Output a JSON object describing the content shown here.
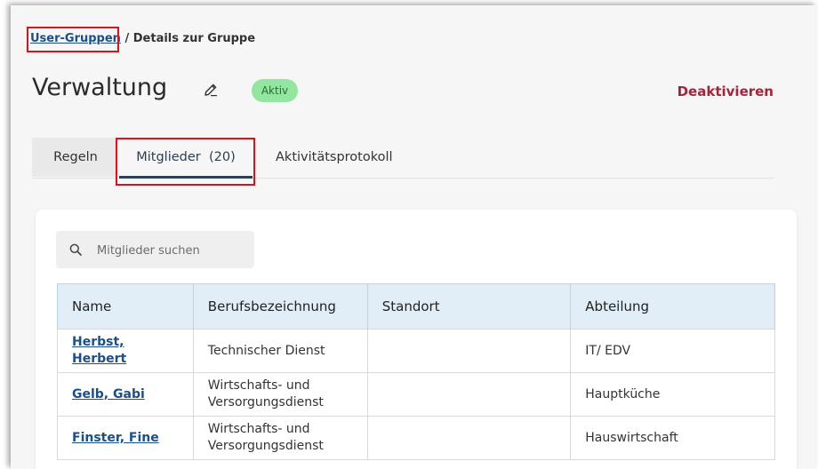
{
  "breadcrumb": {
    "link": "User-Gruppen",
    "separator": " / ",
    "current": "Details zur Gruppe"
  },
  "header": {
    "title": "Verwaltung",
    "status": "Aktiv",
    "deactivate": "Deaktivieren"
  },
  "tabs": [
    {
      "label": "Regeln"
    },
    {
      "label": "Mitglieder  (20)"
    },
    {
      "label": "Aktivitätsprotokoll"
    }
  ],
  "search": {
    "placeholder": "Mitglieder suchen"
  },
  "table": {
    "headers": [
      "Name",
      "Berufsbezeichnung",
      "Standort",
      "Abteilung"
    ],
    "rows": [
      {
        "name": "Herbst, Herbert",
        "job": "Technischer Dienst",
        "location": "",
        "department": "IT/ EDV"
      },
      {
        "name": "Gelb, Gabi",
        "job": "Wirtschafts- und Versorgungsdienst",
        "location": "",
        "department": "Hauptküche"
      },
      {
        "name": "Finster, Fine",
        "job": "Wirtschafts- und Versorgungsdienst",
        "location": "",
        "department": "Hauswirtschaft"
      }
    ]
  },
  "colors": {
    "accent": "#1b4f8a",
    "danger": "#a0263b",
    "badge_bg": "#92e6a0",
    "header_bg": "#e1eef8"
  }
}
